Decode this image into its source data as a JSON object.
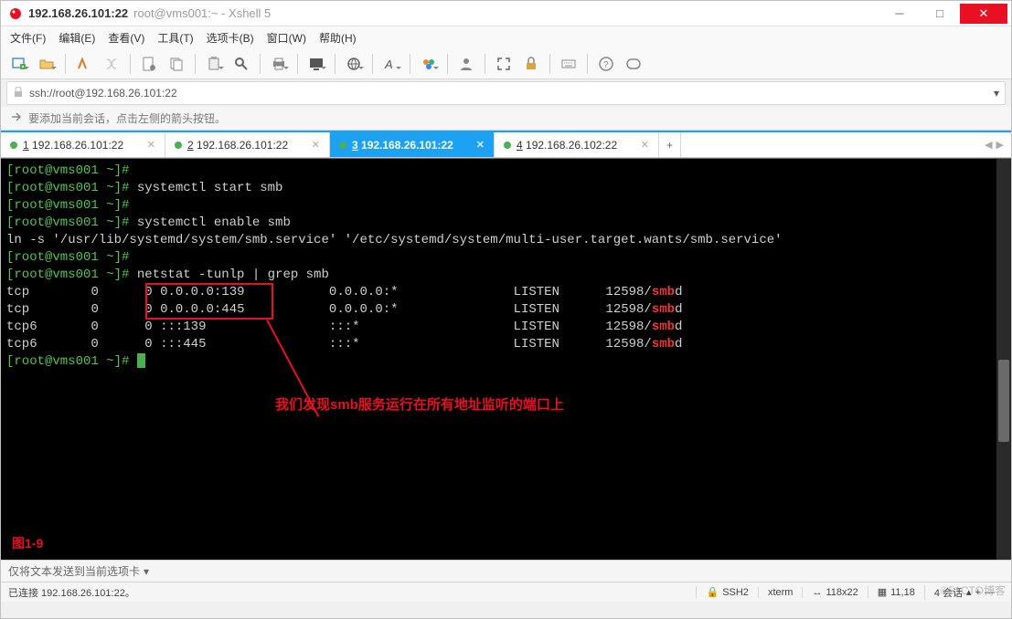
{
  "window": {
    "title_main": "192.168.26.101:22",
    "title_sub": "root@vms001:~ - Xshell 5"
  },
  "menu": {
    "items": [
      "文件(F)",
      "编辑(E)",
      "查看(V)",
      "工具(T)",
      "选项卡(B)",
      "窗口(W)",
      "帮助(H)"
    ]
  },
  "address_bar": {
    "url": "ssh://root@192.168.26.101:22"
  },
  "hint": {
    "text": "要添加当前会话，点击左侧的箭头按钮。"
  },
  "tabs": [
    {
      "index": "1",
      "label": "192.168.26.101:22",
      "active": false
    },
    {
      "index": "2",
      "label": "192.168.26.101:22",
      "active": false
    },
    {
      "index": "3",
      "label": "192.168.26.101:22",
      "active": true
    },
    {
      "index": "4",
      "label": "192.168.26.102:22",
      "active": false
    }
  ],
  "terminal": {
    "prompt": "[root@vms001 ~]#",
    "cmd_start": "systemctl start smb",
    "cmd_enable": "systemctl enable smb",
    "ln_output": "ln -s '/usr/lib/systemd/system/smb.service' '/etc/systemd/system/multi-user.target.wants/smb.service'",
    "cmd_netstat": "netstat -tunlp | grep smb",
    "rows": [
      {
        "proto": "tcp",
        "recv": "0",
        "send": "0",
        "local": "0.0.0.0:139",
        "foreign": "0.0.0.0:*",
        "state": "LISTEN",
        "pid": "12598/",
        "prog": "smb",
        "suffix": "d"
      },
      {
        "proto": "tcp",
        "recv": "0",
        "send": "0",
        "local": "0.0.0.0:445",
        "foreign": "0.0.0.0:*",
        "state": "LISTEN",
        "pid": "12598/",
        "prog": "smb",
        "suffix": "d"
      },
      {
        "proto": "tcp6",
        "recv": "0",
        "send": "0",
        "local": ":::139",
        "foreign": ":::*",
        "state": "LISTEN",
        "pid": "12598/",
        "prog": "smb",
        "suffix": "d"
      },
      {
        "proto": "tcp6",
        "recv": "0",
        "send": "0",
        "local": ":::445",
        "foreign": ":::*",
        "state": "LISTEN",
        "pid": "12598/",
        "prog": "smb",
        "suffix": "d"
      }
    ],
    "annotation": "我们发现smb服务运行在所有地址监听的端口上",
    "figure_label": "图1-9"
  },
  "sendbar": {
    "text": "仅将文本发送到当前选项卡"
  },
  "status": {
    "connection": "已连接 192.168.26.101:22。",
    "proto": "SSH2",
    "term": "xterm",
    "size": "118x22",
    "pos": "11,18",
    "sessions": "4 会话"
  },
  "watermark": "©51CTO博客"
}
